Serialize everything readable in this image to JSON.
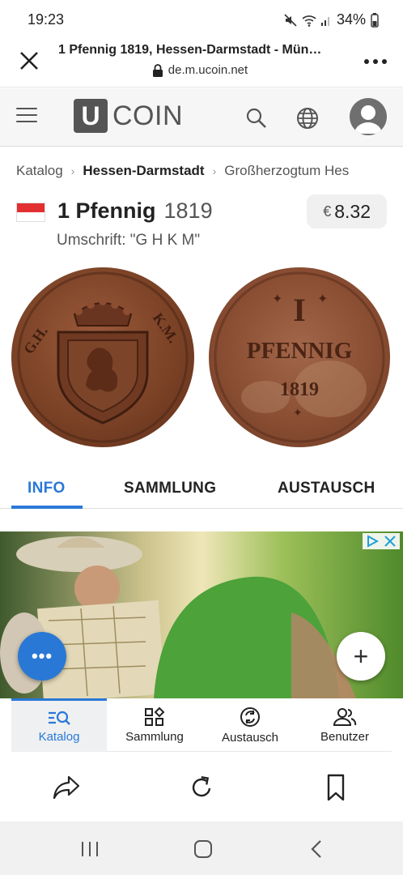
{
  "status_bar": {
    "time": "19:23",
    "battery": "34%"
  },
  "browser": {
    "page_title": "1 Pfennig 1819, Hessen-Darmstadt - Mün…",
    "url": "de.m.ucoin.net"
  },
  "site": {
    "logo_letter": "U",
    "logo_text": "COIN"
  },
  "breadcrumb": [
    {
      "label": "Katalog"
    },
    {
      "label": "Hessen-Darmstadt"
    },
    {
      "label": "Großherzogtum Hes"
    }
  ],
  "coin": {
    "name": "1 Pfennig",
    "year": "1819",
    "subtitle": "Umschrift: \"G H K M\"",
    "price_currency": "€",
    "price_value": "8.32",
    "flag_colors": [
      "#e23030",
      "#ffffff"
    ],
    "obverse_legend_left": "G.H.",
    "obverse_legend_right": "K.M.",
    "reverse_lines": [
      "I",
      "PFENNIG",
      "1819"
    ]
  },
  "tabs": [
    {
      "label": "INFO",
      "active": true
    },
    {
      "label": "SAMMLUNG",
      "active": false
    },
    {
      "label": "AUSTAUSCH",
      "active": false
    }
  ],
  "fab": {
    "menu_glyph": "•••",
    "add_glyph": "+"
  },
  "bottom_nav": [
    {
      "label": "Katalog",
      "icon": "catalog-search-icon",
      "active": true
    },
    {
      "label": "Sammlung",
      "icon": "collection-grid-icon",
      "active": false
    },
    {
      "label": "Austausch",
      "icon": "exchange-icon",
      "active": false
    },
    {
      "label": "Benutzer",
      "icon": "users-icon",
      "active": false
    }
  ],
  "colors": {
    "accent": "#2a78d6",
    "header_bg": "#f6f6f6",
    "logo_gray": "#555555"
  }
}
